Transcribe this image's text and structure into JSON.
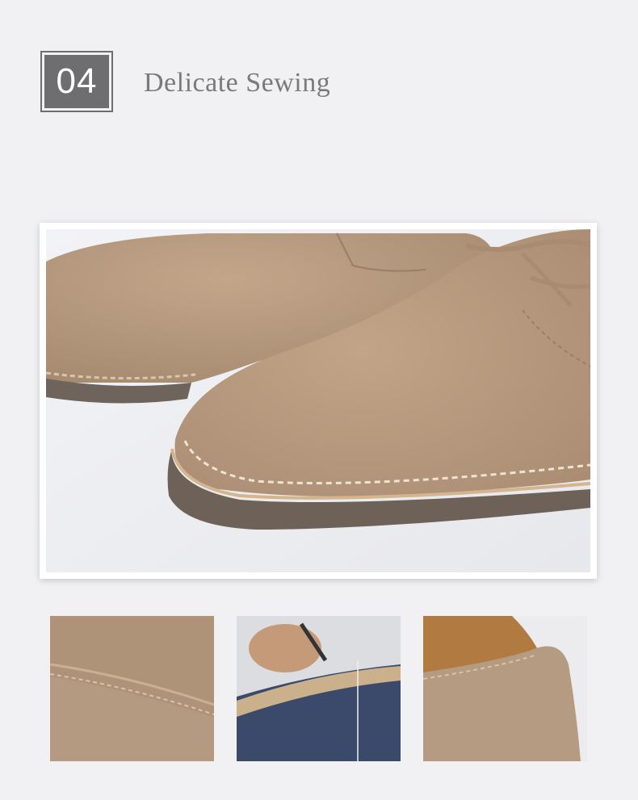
{
  "header": {
    "number": "04",
    "title": "Delicate Sewing"
  },
  "colors": {
    "background": "#f1f1f4",
    "badge": "#6e6e70",
    "suede": "#b89a7f",
    "sole": "#6e6258"
  },
  "images": {
    "main": "suede-shoes-closeup-photo",
    "thumbs": [
      "suede-texture-stitch-photo",
      "hand-stitching-sole-photo",
      "shoe-heel-collar-photo"
    ]
  }
}
